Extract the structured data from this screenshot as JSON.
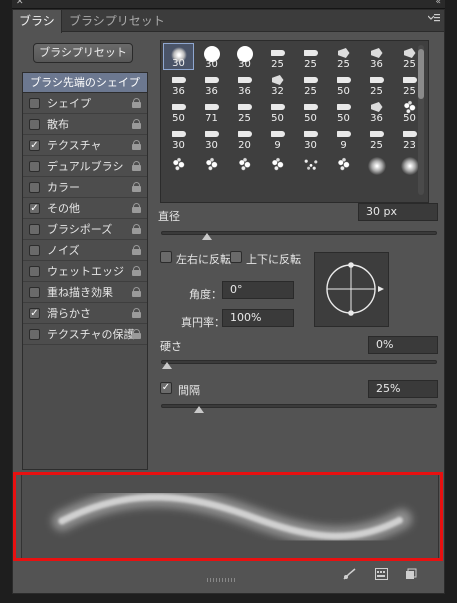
{
  "window": {
    "close_glyph": "✕",
    "collapse_glyph": "«"
  },
  "tabs": [
    {
      "label": "ブラシ",
      "active": true
    },
    {
      "label": "ブラシプリセット",
      "active": false
    }
  ],
  "panel_menu_icon": "panel-menu-icon",
  "preset_button": "ブラシプリセット",
  "sidebar": {
    "header": "ブラシ先端のシェイプ",
    "items": [
      {
        "label": "シェイプ",
        "checked": false
      },
      {
        "label": "散布",
        "checked": false
      },
      {
        "label": "テクスチャ",
        "checked": true
      },
      {
        "label": "デュアルブラシ",
        "checked": false
      },
      {
        "label": "カラー",
        "checked": false
      },
      {
        "label": "その他",
        "checked": true
      },
      {
        "label": "ブラシポーズ",
        "checked": false
      },
      {
        "label": "ノイズ",
        "checked": false
      },
      {
        "label": "ウェットエッジ",
        "checked": false
      },
      {
        "label": "重ね描き効果",
        "checked": false
      },
      {
        "label": "滑らかさ",
        "checked": true
      },
      {
        "label": "テクスチャの保護",
        "checked": false
      }
    ]
  },
  "brush_tips": [
    {
      "size": "30",
      "icon": "soft-round"
    },
    {
      "size": "30",
      "icon": "hard-round"
    },
    {
      "size": "30",
      "icon": "hard-round"
    },
    {
      "size": "25",
      "icon": "tip"
    },
    {
      "size": "25",
      "icon": "tip"
    },
    {
      "size": "25",
      "icon": "tipb"
    },
    {
      "size": "36",
      "icon": "tipb"
    },
    {
      "size": "25",
      "icon": "tipb"
    },
    {
      "size": "36",
      "icon": "tip"
    },
    {
      "size": "36",
      "icon": "tip"
    },
    {
      "size": "36",
      "icon": "tip"
    },
    {
      "size": "32",
      "icon": "tipb"
    },
    {
      "size": "25",
      "icon": "tip"
    },
    {
      "size": "50",
      "icon": "tip"
    },
    {
      "size": "25",
      "icon": "tip"
    },
    {
      "size": "25",
      "icon": "tip"
    },
    {
      "size": "50",
      "icon": "tip"
    },
    {
      "size": "71",
      "icon": "tip"
    },
    {
      "size": "25",
      "icon": "tip"
    },
    {
      "size": "50",
      "icon": "tip"
    },
    {
      "size": "50",
      "icon": "tip"
    },
    {
      "size": "50",
      "icon": "tip"
    },
    {
      "size": "36",
      "icon": "tipb"
    },
    {
      "size": "50",
      "icon": "splat"
    },
    {
      "size": "30",
      "icon": "tip"
    },
    {
      "size": "30",
      "icon": "tip"
    },
    {
      "size": "20",
      "icon": "tip"
    },
    {
      "size": "9",
      "icon": "tip"
    },
    {
      "size": "30",
      "icon": "tip"
    },
    {
      "size": "9",
      "icon": "tip"
    },
    {
      "size": "25",
      "icon": "tip"
    },
    {
      "size": "23",
      "icon": "tip"
    },
    {
      "size": "",
      "icon": "splat"
    },
    {
      "size": "",
      "icon": "splat"
    },
    {
      "size": "",
      "icon": "splat"
    },
    {
      "size": "",
      "icon": "splat"
    },
    {
      "size": "",
      "icon": "dots"
    },
    {
      "size": "",
      "icon": "splat"
    },
    {
      "size": "",
      "icon": "glow"
    },
    {
      "size": "",
      "icon": "glow"
    }
  ],
  "diameter": {
    "label": "直径",
    "value": "30 px",
    "slider_fraction": 0.15
  },
  "flip_x": {
    "label": "左右に反転",
    "checked": false
  },
  "flip_y": {
    "label": "上下に反転",
    "checked": false
  },
  "angle": {
    "label": "角度：",
    "value": "0°"
  },
  "roundness": {
    "label": "真円率：",
    "value": "100%"
  },
  "hardness": {
    "label": "硬さ",
    "value": "0%",
    "slider_fraction": 0.0
  },
  "spacing": {
    "label": "間隔",
    "value": "25%",
    "checked": true,
    "slider_fraction": 0.12
  },
  "footer_icons": [
    "toggle-brush-panel-icon",
    "create-preset-icon",
    "new-brush-icon"
  ]
}
